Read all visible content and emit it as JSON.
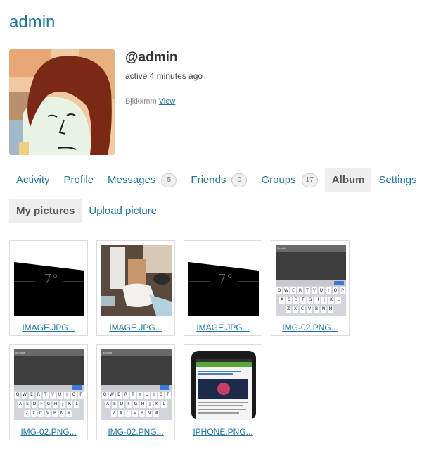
{
  "profile": {
    "title": "admin",
    "username": "@admin",
    "last_active": "active 4 minutes ago",
    "latest_update_text": "Bjkkkmm",
    "latest_update_link": "View"
  },
  "nav": {
    "items": [
      {
        "label": "Activity"
      },
      {
        "label": "Profile"
      },
      {
        "label": "Messages",
        "count": "5"
      },
      {
        "label": "Friends",
        "count": "0"
      },
      {
        "label": "Groups",
        "count": "17"
      },
      {
        "label": "Album",
        "active": true
      },
      {
        "label": "Settings"
      }
    ]
  },
  "subnav": {
    "items": [
      {
        "label": "My pictures",
        "active": true
      },
      {
        "label": "Upload picture"
      }
    ]
  },
  "pictures": [
    {
      "label": "IMAGE.JPG...",
      "kind": "level",
      "reading": "-7°"
    },
    {
      "label": "IMAGE.JPG...",
      "kind": "photo"
    },
    {
      "label": "IMAGE.JPG...",
      "kind": "level",
      "reading": "-7°"
    },
    {
      "label": "IMG-02.PNG...",
      "kind": "keyboard"
    },
    {
      "label": "IMG-02.PNG...",
      "kind": "keyboard"
    },
    {
      "label": "IMG-02.PNG...",
      "kind": "keyboard"
    },
    {
      "label": "IPHONE.PNG...",
      "kind": "phone"
    }
  ],
  "keyboard": {
    "rows": [
      [
        "Q",
        "W",
        "E",
        "R",
        "T",
        "Y",
        "U",
        "I",
        "O",
        "P"
      ],
      [
        "A",
        "S",
        "D",
        "F",
        "G",
        "H",
        "J",
        "K",
        "L"
      ],
      [
        "Z",
        "X",
        "C",
        "V",
        "B",
        "N",
        "M"
      ]
    ],
    "done_label": "Done",
    "top_label": "iBundle"
  },
  "colors": {
    "link": "#21759b",
    "active_tab_bg": "#eeeeee"
  }
}
